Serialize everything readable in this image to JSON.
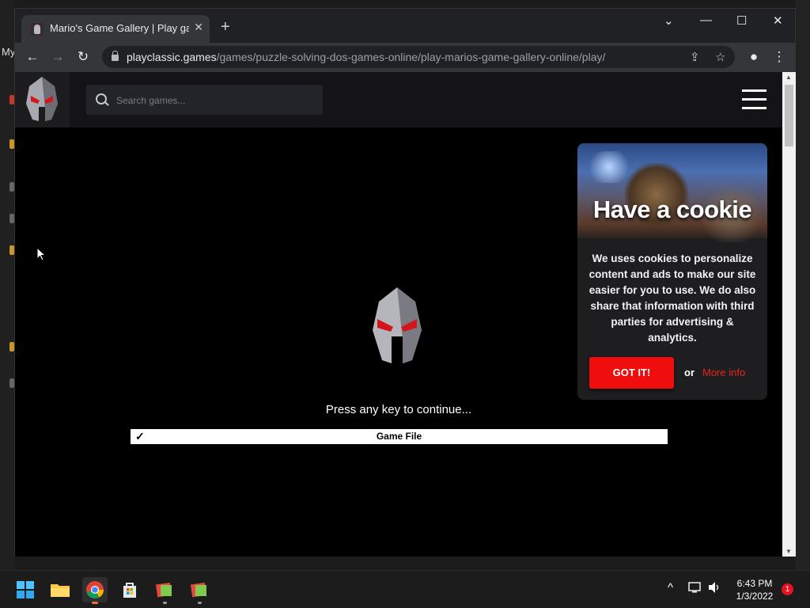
{
  "desktop": {
    "partial_label": "My"
  },
  "browser": {
    "tab_title": "Mario's Game Gallery | Play game",
    "tab_close": "✕",
    "new_tab": "+",
    "window_controls": {
      "dropdown": "⌄",
      "minimize": "—",
      "maximize": "☐",
      "close": "✕"
    },
    "nav": {
      "back": "←",
      "forward": "→",
      "reload": "↻"
    },
    "url_host": "playclassic.games",
    "url_path": "/games/puzzle-solving-dos-games-online/play-marios-game-gallery-online/play/",
    "omnibox_icons": {
      "share": "⇪",
      "bookmark": "☆"
    },
    "profile": "●",
    "menu": "⋮"
  },
  "site": {
    "search_placeholder": "Search games..."
  },
  "game": {
    "prompt": "Press any key to continue...",
    "loading_check": "✓",
    "loading_label": "Game File"
  },
  "cookie": {
    "heading": "Have a cookie",
    "message": "We uses cookies to personalize content and ads to make our site easier for you to use. We do also share that information with third parties for advertising & analytics.",
    "button": "GOT IT!",
    "or": "or",
    "link": "More info"
  },
  "taskbar": {
    "tray_chevron": "^",
    "time": "6:43 PM",
    "date": "1/3/2022",
    "notification_count": "1"
  },
  "colors": {
    "accent_red": "#f00d0d",
    "link_red": "#e8231a",
    "chrome_dark": "#202124"
  }
}
